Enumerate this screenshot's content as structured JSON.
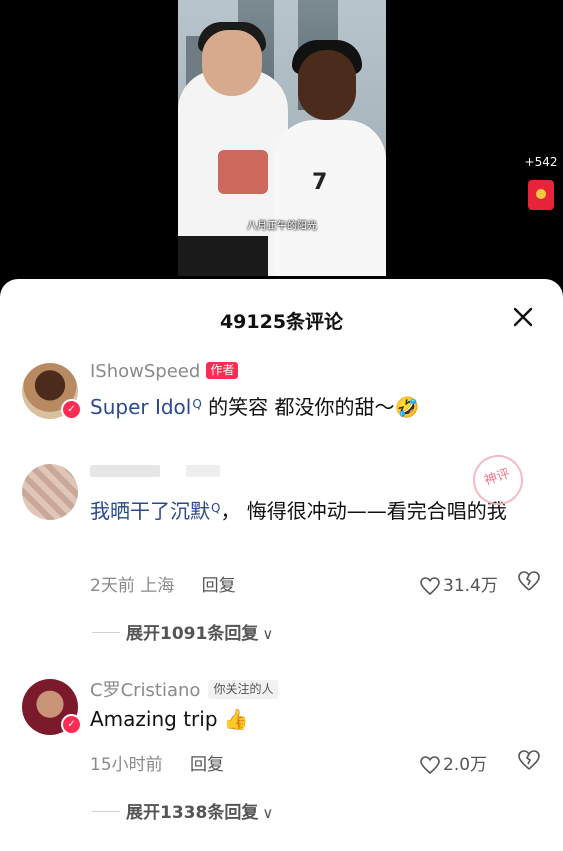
{
  "video": {
    "subtitle": "八月正午的阳光",
    "jersey_number": "7",
    "side_count": "+542"
  },
  "comments_panel": {
    "title": "49125条评论",
    "close_icon": "close-icon"
  },
  "comments": [
    {
      "username": "IShowSpeed",
      "tag": "作者",
      "link_text": "Super Idol",
      "text_rest": " 的笑容 都没你的甜～🤣"
    },
    {
      "username": "",
      "tag": "",
      "badge": "神评",
      "link_text": "我晒干了沉默",
      "text_rest": "， 悔得很冲动——看完合唱的我",
      "time": "2天前",
      "location": "上海",
      "reply": "回复",
      "likes": "31.4万",
      "expand": "展开1091条回复"
    },
    {
      "username": "C罗Cristiano",
      "tag": "你关注的人",
      "text": "Amazing trip 👍",
      "time": "15小时前",
      "reply": "回复",
      "likes": "2.0万",
      "expand": "展开1338条回复"
    }
  ],
  "colors": {
    "accent": "#fe2c55",
    "link": "#2b4a8b",
    "meta": "#8a8a8a"
  }
}
